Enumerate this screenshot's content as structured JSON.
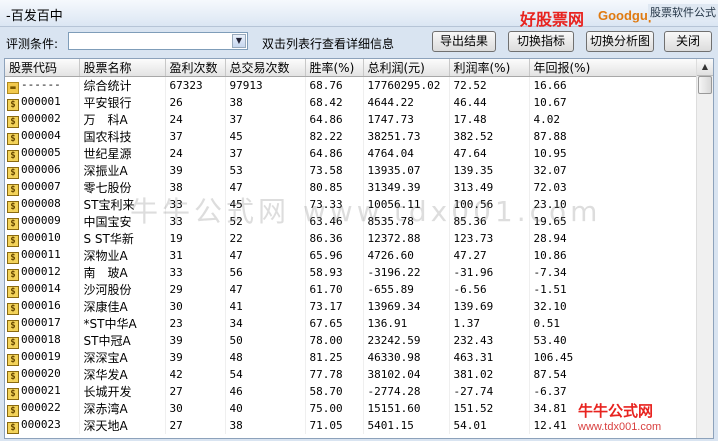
{
  "window": {
    "title": "-百发百中"
  },
  "branding": {
    "logo_left": "好股票网",
    "logo_right": "Goodgupiao.com",
    "logo_sub": "股票软件公式"
  },
  "toolbar": {
    "filter_label": "评测条件:",
    "filter_value": "",
    "hint": "双击列表行查看详细信息",
    "export_label": "导出结果",
    "switch_indicator_label": "切换指标",
    "switch_chart_label": "切换分析图",
    "close_label": "关闭"
  },
  "columns": [
    "股票代码",
    "股票名称",
    "盈利次数",
    "总交易次数",
    "胜率(%)",
    "总利润(元)",
    "利润率(%)",
    "年回报(%)"
  ],
  "rows": [
    {
      "icon": "folder-icon",
      "code": "------",
      "name": "综合统计",
      "wins": "67323",
      "trades": "97913",
      "winrate": "68.76",
      "profit": "17760295.02",
      "margin": "72.52",
      "annual": "16.66"
    },
    {
      "icon": "dollar-icon",
      "code": "000001",
      "name": "平安银行",
      "wins": "26",
      "trades": "38",
      "winrate": "68.42",
      "profit": "4644.22",
      "margin": "46.44",
      "annual": "10.67"
    },
    {
      "icon": "dollar-icon",
      "code": "000002",
      "name": "万　科A",
      "wins": "24",
      "trades": "37",
      "winrate": "64.86",
      "profit": "1747.73",
      "margin": "17.48",
      "annual": "4.02"
    },
    {
      "icon": "dollar-icon",
      "code": "000004",
      "name": "国农科技",
      "wins": "37",
      "trades": "45",
      "winrate": "82.22",
      "profit": "38251.73",
      "margin": "382.52",
      "annual": "87.88"
    },
    {
      "icon": "dollar-icon",
      "code": "000005",
      "name": "世纪星源",
      "wins": "24",
      "trades": "37",
      "winrate": "64.86",
      "profit": "4764.04",
      "margin": "47.64",
      "annual": "10.95"
    },
    {
      "icon": "dollar-icon",
      "code": "000006",
      "name": "深振业A",
      "wins": "39",
      "trades": "53",
      "winrate": "73.58",
      "profit": "13935.07",
      "margin": "139.35",
      "annual": "32.07"
    },
    {
      "icon": "dollar-icon",
      "code": "000007",
      "name": "零七股份",
      "wins": "38",
      "trades": "47",
      "winrate": "80.85",
      "profit": "31349.39",
      "margin": "313.49",
      "annual": "72.03"
    },
    {
      "icon": "dollar-icon",
      "code": "000008",
      "name": "ST宝利来",
      "wins": "33",
      "trades": "45",
      "winrate": "73.33",
      "profit": "10056.11",
      "margin": "100.56",
      "annual": "23.10"
    },
    {
      "icon": "dollar-icon",
      "code": "000009",
      "name": "中国宝安",
      "wins": "33",
      "trades": "52",
      "winrate": "63.46",
      "profit": "8535.78",
      "margin": "85.36",
      "annual": "19.65"
    },
    {
      "icon": "dollar-icon",
      "code": "000010",
      "name": "S ST华新",
      "wins": "19",
      "trades": "22",
      "winrate": "86.36",
      "profit": "12372.88",
      "margin": "123.73",
      "annual": "28.94"
    },
    {
      "icon": "dollar-icon",
      "code": "000011",
      "name": "深物业A",
      "wins": "31",
      "trades": "47",
      "winrate": "65.96",
      "profit": "4726.60",
      "margin": "47.27",
      "annual": "10.86"
    },
    {
      "icon": "dollar-icon",
      "code": "000012",
      "name": "南　玻A",
      "wins": "33",
      "trades": "56",
      "winrate": "58.93",
      "profit": "-3196.22",
      "margin": "-31.96",
      "annual": "-7.34"
    },
    {
      "icon": "dollar-icon",
      "code": "000014",
      "name": "沙河股份",
      "wins": "29",
      "trades": "47",
      "winrate": "61.70",
      "profit": "-655.89",
      "margin": "-6.56",
      "annual": "-1.51"
    },
    {
      "icon": "dollar-icon",
      "code": "000016",
      "name": "深康佳A",
      "wins": "30",
      "trades": "41",
      "winrate": "73.17",
      "profit": "13969.34",
      "margin": "139.69",
      "annual": "32.10"
    },
    {
      "icon": "dollar-icon",
      "code": "000017",
      "name": "*ST中华A",
      "wins": "23",
      "trades": "34",
      "winrate": "67.65",
      "profit": "136.91",
      "margin": "1.37",
      "annual": "0.51"
    },
    {
      "icon": "dollar-icon",
      "code": "000018",
      "name": "ST中冠A",
      "wins": "39",
      "trades": "50",
      "winrate": "78.00",
      "profit": "23242.59",
      "margin": "232.43",
      "annual": "53.40"
    },
    {
      "icon": "dollar-icon",
      "code": "000019",
      "name": "深深宝A",
      "wins": "39",
      "trades": "48",
      "winrate": "81.25",
      "profit": "46330.98",
      "margin": "463.31",
      "annual": "106.45"
    },
    {
      "icon": "dollar-icon",
      "code": "000020",
      "name": "深华发A",
      "wins": "42",
      "trades": "54",
      "winrate": "77.78",
      "profit": "38102.04",
      "margin": "381.02",
      "annual": "87.54"
    },
    {
      "icon": "dollar-icon",
      "code": "000021",
      "name": "长城开发",
      "wins": "27",
      "trades": "46",
      "winrate": "58.70",
      "profit": "-2774.28",
      "margin": "-27.74",
      "annual": "-6.37"
    },
    {
      "icon": "dollar-icon",
      "code": "000022",
      "name": "深赤湾A",
      "wins": "30",
      "trades": "40",
      "winrate": "75.00",
      "profit": "15151.60",
      "margin": "151.52",
      "annual": "34.81"
    },
    {
      "icon": "dollar-icon",
      "code": "000023",
      "name": "深天地A",
      "wins": "27",
      "trades": "38",
      "winrate": "71.05",
      "profit": "5401.15",
      "margin": "54.01",
      "annual": "12.41"
    }
  ],
  "watermark": {
    "text": "牛牛公式网 www.tdx001.com"
  },
  "badge": {
    "top": "牛牛公式网",
    "bottom": "www.tdx001.com"
  }
}
